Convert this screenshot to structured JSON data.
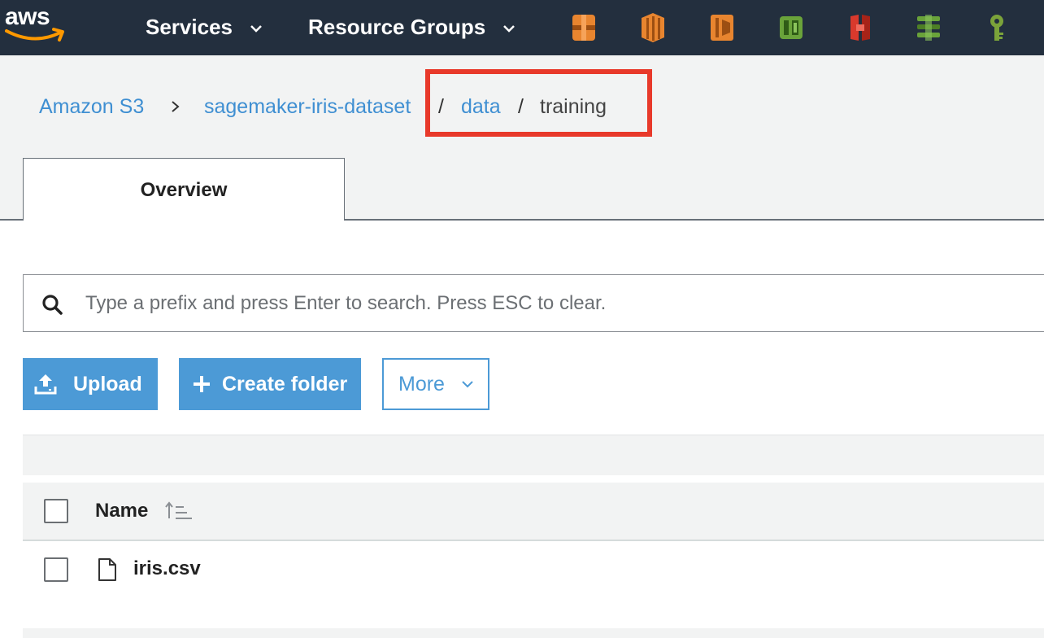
{
  "topnav": {
    "logo_text": "aws",
    "services_label": "Services",
    "resource_groups_label": "Resource Groups",
    "service_icons": [
      "ec2-icon",
      "ec2-instance-icon",
      "ecs-icon",
      "elastic-beanstalk-icon",
      "codedeploy-icon",
      "elasticache-icon",
      "iam-key-icon"
    ],
    "colors": {
      "background": "#232f3e",
      "compute_orange": "#e8852f",
      "green": "#6aa33a",
      "red": "#d9392c",
      "olive": "#7ba33a"
    }
  },
  "breadcrumb": {
    "root": "Amazon S3",
    "bucket": "sagemaker-iris-dataset",
    "folder": "data",
    "current": "training",
    "separator": "/"
  },
  "tabs": [
    {
      "label": "Overview",
      "active": true
    }
  ],
  "search": {
    "placeholder": "Type a prefix and press Enter to search. Press ESC to clear.",
    "value": ""
  },
  "actions": {
    "upload_label": "Upload",
    "create_folder_label": "Create folder",
    "more_label": "More"
  },
  "table": {
    "columns": [
      {
        "label": "Name"
      }
    ],
    "rows": [
      {
        "name": "iris.csv"
      }
    ]
  },
  "highlight_color": "#e8392a",
  "accent_color": "#4c9ad6"
}
